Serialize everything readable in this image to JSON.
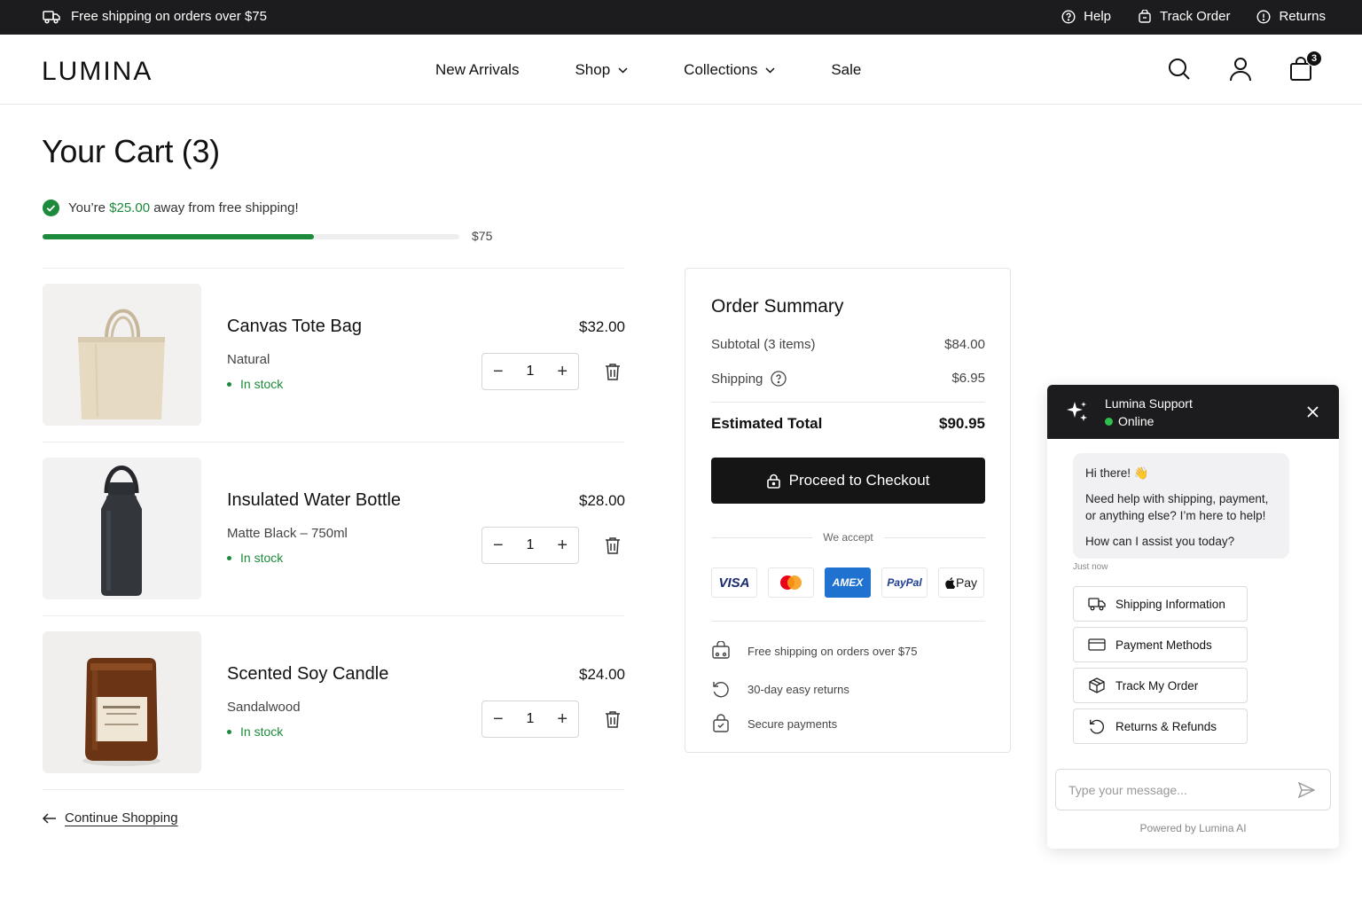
{
  "announcement": {
    "text": "Free shipping on orders over $75",
    "links": [
      "Help",
      "Track Order",
      "Returns"
    ]
  },
  "header": {
    "logo": "LUMINA",
    "nav": [
      "New Arrivals",
      "Shop",
      "Collections",
      "Sale"
    ],
    "cart_count": "3"
  },
  "cart": {
    "title": "Your Cart (3)",
    "shipping_msg_prefix": "You’re",
    "shipping_msg_amount": "$25.00",
    "shipping_msg_suffix": "away from free shipping!",
    "shipping_goal": "$75",
    "shipping_progress": 0.65,
    "items": [
      {
        "name": "Canvas Tote Bag",
        "variant": "Natural",
        "stock": "In stock",
        "price": "$32.00",
        "qty": "1"
      },
      {
        "name": "Insulated Water Bottle",
        "variant": "Matte Black – 750ml",
        "stock": "In stock",
        "price": "$28.00",
        "qty": "1"
      },
      {
        "name": "Scented Soy Candle",
        "variant": "Sandalwood",
        "stock": "In stock",
        "price": "$24.00",
        "qty": "1"
      }
    ],
    "continue": "Continue Shopping"
  },
  "summary": {
    "title": "Order Summary",
    "subtotal_label": "Subtotal (3 items)",
    "subtotal_value": "$84.00",
    "shipping_label": "Shipping",
    "shipping_value": "$6.95",
    "total_label": "Estimated Total",
    "total_value": "$90.95",
    "checkout": "Proceed to Checkout",
    "accept_label": "We accept",
    "cards": [
      "VISA",
      "Mastercard",
      "AMEX",
      "PayPal",
      "Pay"
    ],
    "perks": [
      "Free shipping on orders over $75",
      "30-day easy returns",
      "Secure payments"
    ]
  },
  "chat": {
    "title": "Lumina Support",
    "status": "Online",
    "greeting": "Hi there! 👋",
    "message": "Need help with shipping, payment, or anything else? I’m here to help!",
    "question": "How can I assist you today?",
    "time": "Just now",
    "quick_replies": [
      "Shipping Information",
      "Payment Methods",
      "Track My Order",
      "Returns & Refunds"
    ],
    "input_placeholder": "Type your message...",
    "powered": "Powered by Lumina AI"
  },
  "colors": {
    "accent_green": "#1b8a3a",
    "dark": "#1c1c1e",
    "amex_blue": "#1f72cf"
  }
}
